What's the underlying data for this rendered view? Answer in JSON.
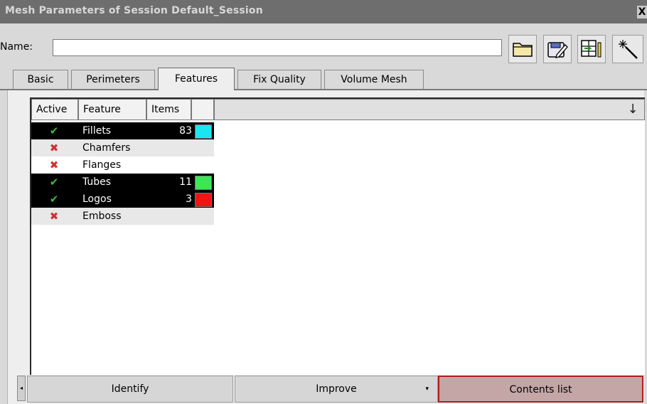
{
  "window": {
    "title": "Mesh Parameters of Session Default_Session",
    "close_label": "X"
  },
  "name_field": {
    "label": "Name:",
    "value": ""
  },
  "toolbar": {
    "icons": [
      "folder-icon",
      "save-edit-icon",
      "export-grid-icon",
      "magic-wand-icon"
    ]
  },
  "tabs": [
    {
      "label": "Basic"
    },
    {
      "label": "Perimeters"
    },
    {
      "label": "Features",
      "active": true
    },
    {
      "label": "Fix Quality"
    },
    {
      "label": "Volume Mesh"
    }
  ],
  "table": {
    "headers": [
      "Active",
      "Feature",
      "Items",
      ""
    ],
    "sort_icon": "↓",
    "rows": [
      {
        "active": true,
        "feature": "Fillets",
        "items": "83",
        "color": "#19e6f0"
      },
      {
        "active": false,
        "feature": "Chamfers",
        "items": "",
        "color": ""
      },
      {
        "active": false,
        "feature": "Flanges",
        "items": "",
        "color": ""
      },
      {
        "active": true,
        "feature": "Tubes",
        "items": "11",
        "color": "#3de657"
      },
      {
        "active": true,
        "feature": "Logos",
        "items": "3",
        "color": "#f01414"
      },
      {
        "active": false,
        "feature": "Emboss",
        "items": "",
        "color": ""
      }
    ]
  },
  "bottom": {
    "scroll_left": "◂",
    "identify_label": "Identify",
    "improve_label": "Improve",
    "improve_arrow": "▾",
    "contents_label": "Contents list"
  },
  "glyphs": {
    "check": "✔",
    "cross": "✖"
  }
}
